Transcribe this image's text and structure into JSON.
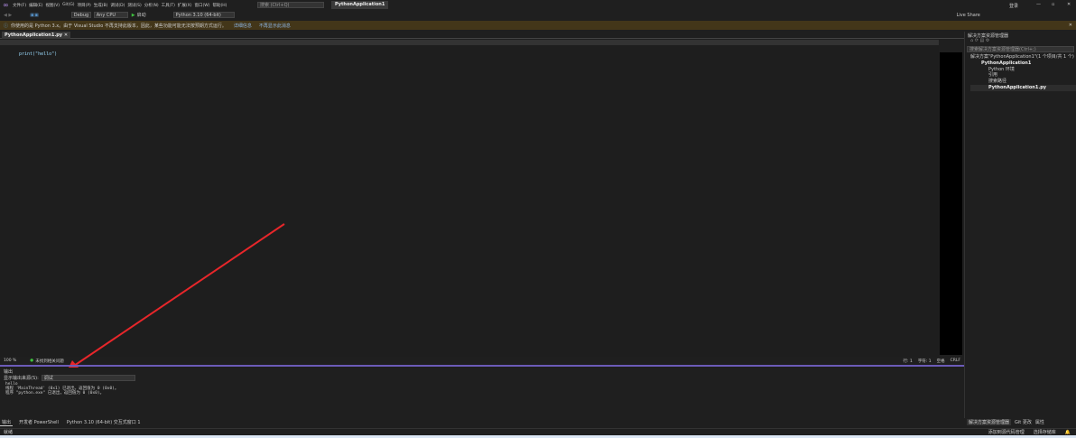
{
  "menu": [
    "文件(F)",
    "编辑(E)",
    "视图(V)",
    "Git(G)",
    "项目(P)",
    "生成(B)",
    "调试(D)",
    "测试(S)",
    "分析(N)",
    "工具(T)",
    "扩展(X)",
    "窗口(W)",
    "帮助(H)"
  ],
  "search_placeholder": "搜索 (Ctrl+Q)",
  "solution_name": "PythonApplication1",
  "login": "登录",
  "live_share": "Live Share",
  "toolbar": {
    "config": "Debug",
    "platform": "Any CPU",
    "start": "启动",
    "env": "Python 3.10 (64-bit)"
  },
  "info": {
    "message": "你使用的是 Python 3.x。由于 Visual Studio 不再支持此版本，因此，某些功能可能无法按预期方式运行。",
    "link1": "详细信息",
    "link2": "不再显示此消息"
  },
  "doc_tab": "PythonApplication1.py",
  "code": "print(\"hello\")",
  "editor_status": {
    "zoom": "100 %",
    "issues": "未找到相关问题",
    "line": "行: 1",
    "col": "字符: 1",
    "mode": "空格",
    "eol": "CRLF"
  },
  "output": {
    "title": "输出",
    "source_label": "显示输出来源(S):",
    "source": "调试",
    "lines": [
      "hello",
      "线程 'MainThread' (0x1) 已退出，返回值为 0 (0x0)。",
      "程序 \"python.exe\" 已退出，返回值为 0 (0x0)。"
    ]
  },
  "bottom_tabs": [
    "输出",
    "开发者 PowerShell",
    "Python 3.10 (64-bit) 交互式窗口 1"
  ],
  "solution_explorer": {
    "title": "解决方案资源管理器",
    "search": "搜索解决方案资源管理器(Ctrl+;)",
    "items": [
      "解决方案\"PythonApplication1\"(1 个项目/共 1 个)",
      "PythonApplication1",
      "Python 环境",
      "引用",
      "搜索路径",
      "PythonApplication1.py"
    ],
    "tabs": [
      "解决方案资源管理器",
      "Git 更改",
      "属性"
    ]
  },
  "statusbar": {
    "ready": "就绪",
    "source_control": "添加到源代码管理",
    "repo": "选择存储库"
  }
}
